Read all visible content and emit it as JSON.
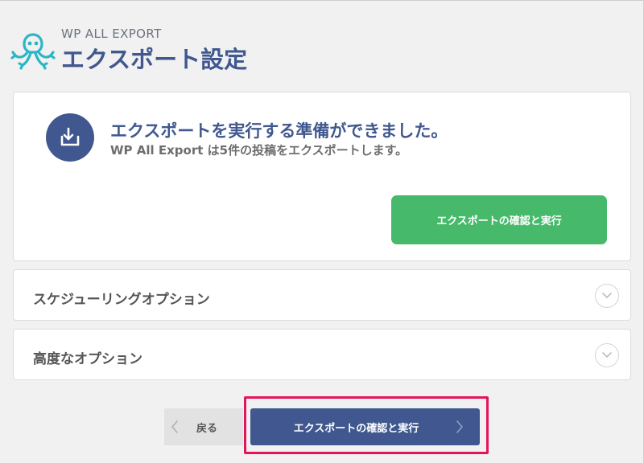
{
  "header": {
    "brand": "WP ALL EXPORT",
    "title": "エクスポート設定"
  },
  "ready_panel": {
    "title": "エクスポートを実行する準備ができました。",
    "subtitle": "WP All Export は5件の投稿をエクスポートします。",
    "confirm_button": "エクスポートの確認と実行"
  },
  "accordions": [
    {
      "label": "スケジューリングオプション",
      "icon": "chevron-down-icon"
    },
    {
      "label": "高度なオプション",
      "icon": "chevron-down-icon"
    }
  ],
  "footer": {
    "back_label": "戻る",
    "run_label": "エクスポートの確認と実行"
  },
  "colors": {
    "brand_blue": "#40588f",
    "logo_teal": "#2bb6c5",
    "confirm_green": "#46b96a",
    "highlight_pink": "#e5145a"
  }
}
